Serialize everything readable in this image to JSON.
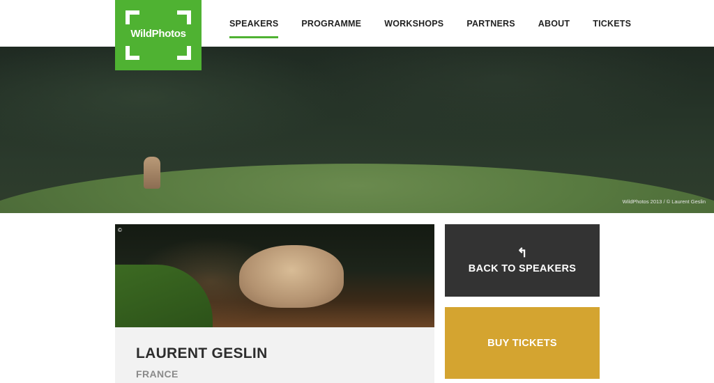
{
  "brand": {
    "logo_text": "WildPhotos",
    "accent_color": "#4fb232"
  },
  "nav": {
    "items": [
      {
        "label": "SPEAKERS",
        "active": true
      },
      {
        "label": "PROGRAMME",
        "active": false
      },
      {
        "label": "WORKSHOPS",
        "active": false
      },
      {
        "label": "PARTNERS",
        "active": false
      },
      {
        "label": "ABOUT",
        "active": false
      },
      {
        "label": "TICKETS",
        "active": false
      }
    ]
  },
  "hero": {
    "credit": "WildPhotos 2013 / © Laurent Geslin"
  },
  "speaker": {
    "photo_mark": "©",
    "name": "LAURENT GESLIN",
    "country": "FRANCE"
  },
  "actions": {
    "back": {
      "icon": "back-arrow-icon",
      "label": "BACK TO SPEAKERS",
      "color": "#333333"
    },
    "tickets": {
      "label": "BUY TICKETS",
      "color": "#d4a430"
    }
  }
}
